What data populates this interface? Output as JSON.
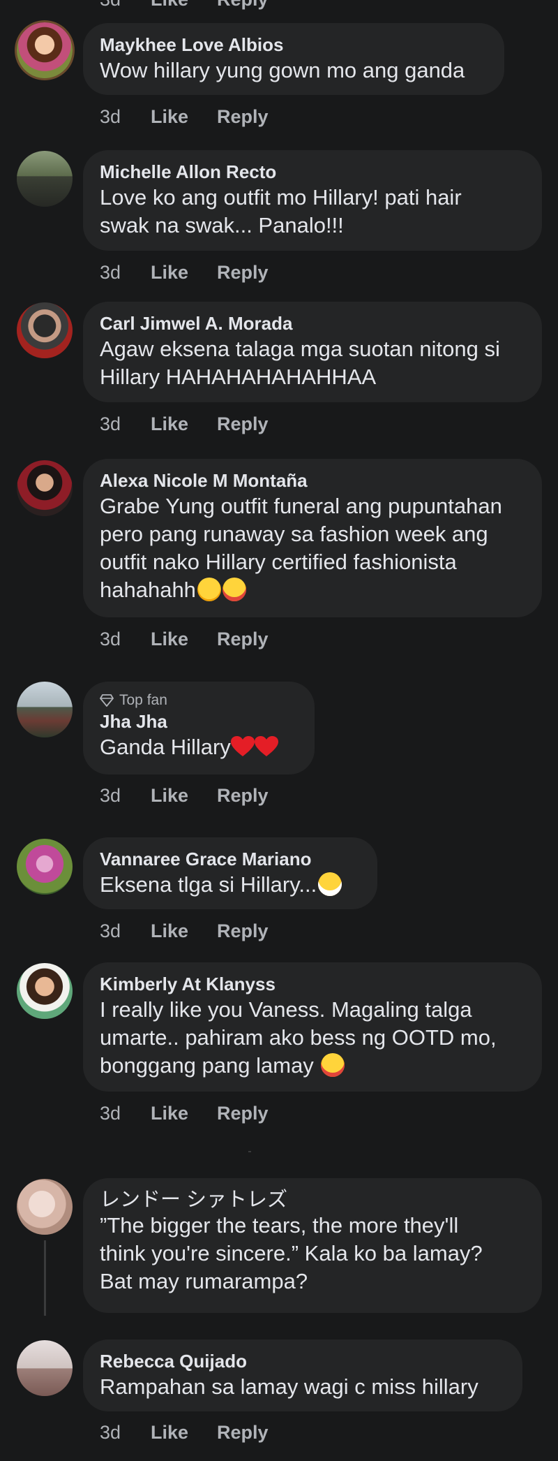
{
  "actions": {
    "like": "Like",
    "reply": "Reply"
  },
  "comments": [
    {
      "name": "Maykhee Love Albios",
      "text": [
        "Wow hillary yung gown mo ang ganda"
      ],
      "time": "3d"
    },
    {
      "name": "Michelle Allon Recto",
      "text": [
        "Love ko ang outfit mo Hillary!   pati hair",
        "swak na swak... Panalo!!!"
      ],
      "time": "3d"
    },
    {
      "name": "Carl Jimwel A. Morada",
      "text": [
        "Agaw eksena talaga mga suotan nitong si",
        "Hillary HAHAHAHAHAHHAA"
      ],
      "time": "3d"
    },
    {
      "name": "Alexa Nicole M Montaña",
      "text": [
        "Grabe Yung outfit funeral ang pupuntahan",
        "pero pang runaway sa fashion week ang",
        "outfit nako Hillary certified fashionista",
        "hahahahh"
      ],
      "emoji": [
        "sweat-smile",
        "joy"
      ],
      "time": "3d"
    },
    {
      "badge": "Top fan",
      "name": "Jha Jha",
      "text": [
        "Ganda Hillary"
      ],
      "emoji": [
        "heart",
        "heart"
      ],
      "time": "3d"
    },
    {
      "name": "Vannaree Grace Mariano",
      "text": [
        "Eksena tlga si Hillary..."
      ],
      "emoji": [
        "grin"
      ],
      "time": "3d"
    },
    {
      "name": "Kimberly At Klanyss",
      "text": [
        "I really like you Vaness. Magaling talga",
        "umarte.. pahiram ako bess ng OOTD mo,",
        "bonggang pang lamay "
      ],
      "emoji": [
        "joy"
      ],
      "time": "3d"
    },
    {
      "name": "レンドー シァトレズ",
      "text": [
        "”The bigger the tears, the more they'll",
        "think you're sincere.” Kala ko ba lamay?",
        "Bat may rumarampa?"
      ]
    },
    {
      "name": "Rebecca Quijado",
      "text": [
        "Rampahan sa lamay wagi c miss hillary"
      ],
      "time": "3d"
    }
  ],
  "colors": {
    "background": "#18191a",
    "bubble": "#242526",
    "primary_text": "#e4e6eb",
    "secondary_text": "#b0b3b8"
  }
}
